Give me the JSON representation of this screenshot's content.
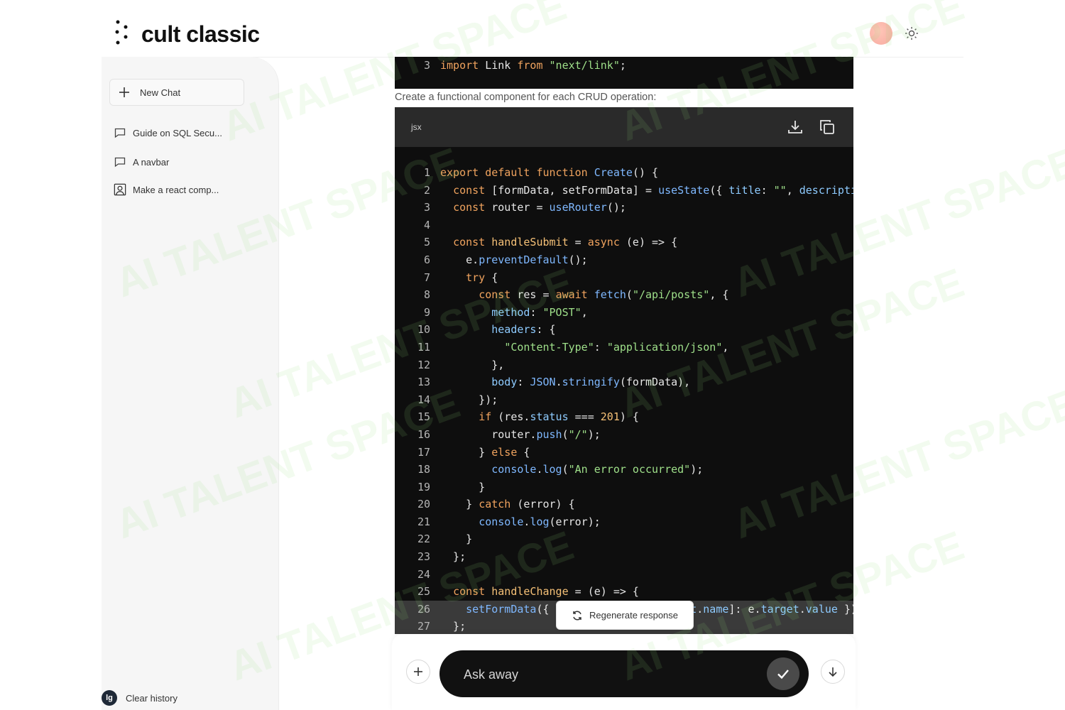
{
  "header": {
    "app_title": "cult classic"
  },
  "sidebar": {
    "new_chat_label": "New Chat",
    "chats": [
      {
        "label": "Guide on SQL Secu..."
      },
      {
        "label": "A navbar"
      },
      {
        "label": "Make a react comp..."
      }
    ],
    "user_initials": "lg",
    "clear_history_label": "Clear history"
  },
  "main": {
    "top_code_line_number": "3",
    "instruction": "Create a functional component for each CRUD operation:",
    "code_language": "jsx",
    "regenerate_label": "Regenerate response",
    "input_placeholder": "Ask away"
  },
  "watermark_text": "AI TALENT SPACE"
}
